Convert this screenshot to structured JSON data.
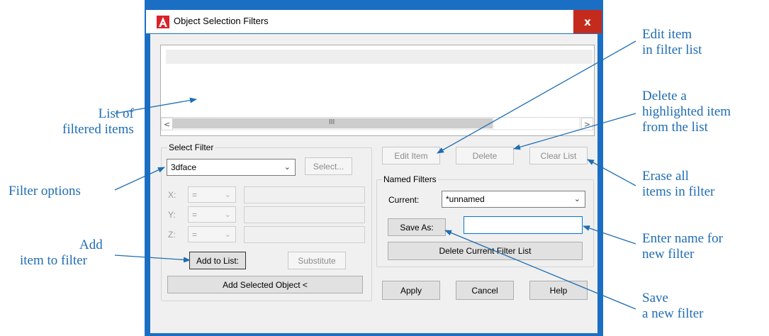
{
  "window": {
    "title": "Object Selection Filters",
    "close_glyph": "x",
    "icon": "autocad-logo-icon"
  },
  "list": {
    "scroll_left": "<",
    "scroll_right": ">",
    "grip": "III"
  },
  "select_filter": {
    "group_label": "Select Filter",
    "filter_value": "3dface",
    "select_button": "Select...",
    "axes": [
      {
        "label": "X:",
        "operator": "="
      },
      {
        "label": "Y:",
        "operator": "="
      },
      {
        "label": "Z:",
        "operator": "="
      }
    ],
    "add_to_list": "Add to List:",
    "substitute": "Substitute",
    "add_selected": "Add Selected Object <"
  },
  "list_actions": {
    "edit_item": "Edit Item",
    "delete": "Delete",
    "clear_list": "Clear List"
  },
  "named_filters": {
    "group_label": "Named Filters",
    "current_label": "Current:",
    "current_value": "*unnamed",
    "save_as": "Save As:",
    "save_as_value": "",
    "delete_current": "Delete Current Filter List"
  },
  "footer": {
    "apply": "Apply",
    "cancel": "Cancel",
    "help": "Help"
  },
  "callouts": {
    "list_items": [
      "List of",
      "filtered items"
    ],
    "filter_options": [
      "Filter options"
    ],
    "add_item": [
      "Add",
      "item to filter"
    ],
    "edit_item": [
      "Edit item",
      "in filter list"
    ],
    "delete_item": [
      "Delete a",
      "highlighted item",
      "from the list"
    ],
    "erase_all": [
      "Erase all",
      "items in filter"
    ],
    "enter_name": [
      "Enter name for",
      "new filter"
    ],
    "save_new": [
      "Save",
      "a new filter"
    ]
  },
  "colors": {
    "frame": "#1a6fc4",
    "close": "#c42b1c",
    "callout": "#1f6db3"
  }
}
